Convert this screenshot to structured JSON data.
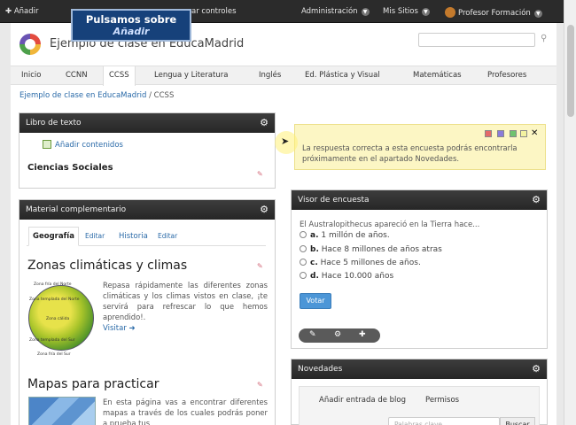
{
  "dockbar": {
    "add_label": "Añadir",
    "manage_partial": "ar controles",
    "admin_label": "Administración",
    "sites_label": "Mis Sitios",
    "user_label": "Profesor Formación"
  },
  "callout": {
    "line1": "Pulsamos sobre",
    "line2": "Añadir"
  },
  "header": {
    "title": "Ejemplo de clase en EducaMadrid"
  },
  "nav": {
    "tabs": [
      "Inicio",
      "CCNN",
      "CCSS",
      "Lengua y Literatura",
      "Inglés",
      "Ed. Plástica y Visual",
      "Matemáticas",
      "Profesores"
    ],
    "active": "CCSS"
  },
  "breadcrumb": {
    "root": "Ejemplo de clase en EducaMadrid",
    "separator": "/",
    "current": "CCSS"
  },
  "textbook": {
    "title": "Libro de texto",
    "add_content": "Añadir contenidos",
    "subject": "Ciencias Sociales"
  },
  "material": {
    "title": "Material complementario",
    "tabs": [
      {
        "label": "Geografía",
        "edit": "Editar"
      },
      {
        "label": "Historia",
        "edit": "Editar"
      }
    ],
    "article1": {
      "title": "Zonas climáticas y climas",
      "body": "Repasa rápidamente las diferentes zonas climáticas y los climas vistos en clase, ¡te servirá para refrescar lo que hemos aprendido!.",
      "visit": "Visitar"
    },
    "article2": {
      "title": "Mapas para practicar",
      "body": "En esta página vas a encontrar diferentes mapas a través de los cuales podrás poner a prueba tus"
    },
    "globe_labels": [
      "Zona fría del Norte",
      "Zona templada del Norte",
      "Zona cálida",
      "Zona templada del Sur",
      "Zona fría del Sur"
    ]
  },
  "notice": {
    "text": "La respuesta correcta a esta encuesta podrás encontrarla próximamente en el apartado Novedades.",
    "colors": [
      "#e46a6a",
      "#8a7bd9",
      "#6fc26f",
      "#f2f2a0"
    ]
  },
  "poll": {
    "title": "Visor de encuesta",
    "question": "El Australopithecus apareció en la Tierra hace...",
    "options": [
      {
        "key": "a.",
        "text": "1 millón de años."
      },
      {
        "key": "b.",
        "text": "Hace 8 millones de años atras"
      },
      {
        "key": "c.",
        "text": "Hace 5 millones de años."
      },
      {
        "key": "d.",
        "text": "Hace 10.000 años"
      }
    ],
    "vote": "Votar"
  },
  "news": {
    "title": "Novedades",
    "add_entry": "Añadir entrada de blog",
    "permissions": "Permisos",
    "search_placeholder": "Palabras clave",
    "search_button": "Buscar"
  }
}
